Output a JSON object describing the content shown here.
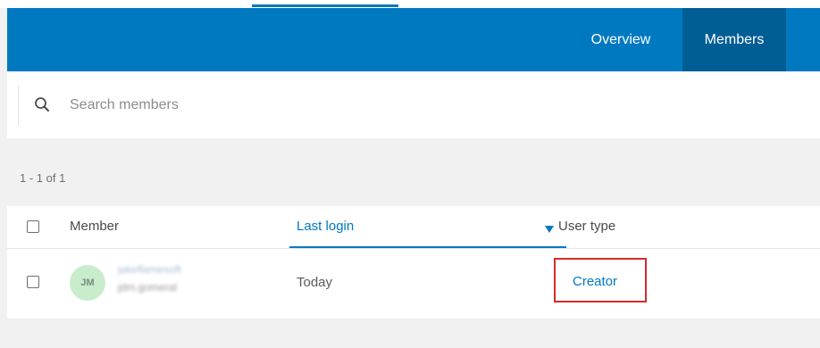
{
  "nav": {
    "tabs": [
      {
        "label": "Overview",
        "active": false
      },
      {
        "label": "Members",
        "active": true
      }
    ]
  },
  "search": {
    "placeholder": "Search members",
    "value": ""
  },
  "results": {
    "count_text": "1 - 1 of 1"
  },
  "table": {
    "columns": {
      "member": "Member",
      "last_login": "Last login",
      "user_type": "User type"
    },
    "sort": {
      "column": "last_login",
      "direction": "descending"
    },
    "rows": [
      {
        "avatar_initials": "JM",
        "name": "jakeflamesoft",
        "username": "jdm.gomeral",
        "last_login": "Today",
        "user_type": "Creator"
      }
    ]
  },
  "icons": {
    "search": "search-icon",
    "sort": "caret-down-icon"
  },
  "colors": {
    "brand_blue": "#0079c1",
    "active_tab": "#005e95",
    "avatar_bg": "#c9eccd",
    "highlight_border": "#d42b2b"
  }
}
